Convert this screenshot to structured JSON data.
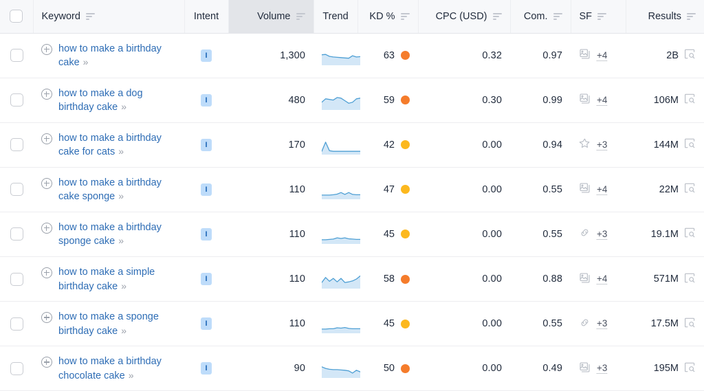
{
  "table": {
    "columns": [
      {
        "key": "checkbox",
        "label": "",
        "sortable": false,
        "align": "center",
        "sorted": false
      },
      {
        "key": "keyword",
        "label": "Keyword",
        "sortable": true,
        "align": "left",
        "sorted": false
      },
      {
        "key": "intent",
        "label": "Intent",
        "sortable": false,
        "align": "center",
        "sorted": false
      },
      {
        "key": "volume",
        "label": "Volume",
        "sortable": true,
        "align": "right",
        "sorted": true
      },
      {
        "key": "trend",
        "label": "Trend",
        "sortable": false,
        "align": "center",
        "sorted": false
      },
      {
        "key": "kd",
        "label": "KD %",
        "sortable": true,
        "align": "right",
        "sorted": false
      },
      {
        "key": "cpc",
        "label": "CPC (USD)",
        "sortable": true,
        "align": "right",
        "sorted": false
      },
      {
        "key": "com",
        "label": "Com.",
        "sortable": true,
        "align": "right",
        "sorted": false
      },
      {
        "key": "sf",
        "label": "SF",
        "sortable": true,
        "align": "left",
        "sorted": false
      },
      {
        "key": "results",
        "label": "Results",
        "sortable": true,
        "align": "right",
        "sorted": false
      }
    ],
    "select_all_checked": false,
    "colors": {
      "header_bg": "#f7f8fa",
      "header_sorted_bg": "#e3e5e9",
      "link": "#2e6db5",
      "intent_badge_bg": "#bedcfa",
      "intent_badge_text": "#1b64b5",
      "kd_orange": "#f57c2b",
      "kd_yellow": "#fcb81e",
      "spark_line": "#4e9fd4",
      "spark_fill": "#d3e7f7",
      "icon_gray": "#b9bec6"
    },
    "rows": [
      {
        "checked": false,
        "keyword": "how to make a birthday cake",
        "expand_icon": "plus-circle-icon",
        "more_icon": "chevron-double-right-icon",
        "intent": "I",
        "intent_name": "informational",
        "volume": "1,300",
        "trend": [
          58,
          60,
          48,
          44,
          42,
          40,
          38,
          36,
          52,
          44,
          46
        ],
        "kd": "63",
        "kd_color": "#f57c2b",
        "cpc": "0.32",
        "com": "0.97",
        "sf_icon": "images-icon",
        "sf_more": "+4",
        "results": "2B",
        "results_icon": "serp-preview-icon"
      },
      {
        "checked": false,
        "keyword": "how to make a dog birthday cake",
        "expand_icon": "plus-circle-icon",
        "more_icon": "chevron-double-right-icon",
        "intent": "I",
        "intent_name": "informational",
        "volume": "480",
        "trend": [
          40,
          62,
          58,
          54,
          70,
          66,
          50,
          34,
          40,
          62,
          66
        ],
        "kd": "59",
        "kd_color": "#f57c2b",
        "cpc": "0.30",
        "com": "0.99",
        "sf_icon": "images-icon",
        "sf_more": "+4",
        "results": "106M",
        "results_icon": "serp-preview-icon"
      },
      {
        "checked": false,
        "keyword": "how to make a birthday cake for cats",
        "expand_icon": "plus-circle-icon",
        "more_icon": "chevron-double-right-icon",
        "intent": "I",
        "intent_name": "informational",
        "volume": "170",
        "trend": [
          12,
          70,
          16,
          12,
          12,
          12,
          12,
          12,
          12,
          12,
          12
        ],
        "kd": "42",
        "kd_color": "#fcb81e",
        "cpc": "0.00",
        "com": "0.94",
        "sf_icon": "star-icon",
        "sf_more": "+3",
        "results": "144M",
        "results_icon": "serp-preview-icon"
      },
      {
        "checked": false,
        "keyword": "how to make a birthday cake sponge",
        "expand_icon": "plus-circle-icon",
        "more_icon": "chevron-double-right-icon",
        "intent": "I",
        "intent_name": "informational",
        "volume": "110",
        "trend": [
          18,
          18,
          18,
          20,
          24,
          34,
          22,
          34,
          22,
          20,
          20
        ],
        "kd": "47",
        "kd_color": "#fcb81e",
        "cpc": "0.00",
        "com": "0.55",
        "sf_icon": "images-icon",
        "sf_more": "+4",
        "results": "22M",
        "results_icon": "serp-preview-icon"
      },
      {
        "checked": false,
        "keyword": "how to make a birthday sponge cake",
        "expand_icon": "plus-circle-icon",
        "more_icon": "chevron-double-right-icon",
        "intent": "I",
        "intent_name": "informational",
        "volume": "110",
        "trend": [
          18,
          18,
          20,
          22,
          30,
          26,
          30,
          24,
          22,
          20,
          20
        ],
        "kd": "45",
        "kd_color": "#fcb81e",
        "cpc": "0.00",
        "com": "0.55",
        "sf_icon": "link-icon",
        "sf_more": "+3",
        "results": "19.1M",
        "results_icon": "serp-preview-icon"
      },
      {
        "checked": false,
        "keyword": "how to make a simple birthday cake",
        "expand_icon": "plus-circle-icon",
        "more_icon": "chevron-double-right-icon",
        "intent": "I",
        "intent_name": "informational",
        "volume": "110",
        "trend": [
          30,
          62,
          38,
          56,
          34,
          56,
          30,
          34,
          40,
          52,
          72
        ],
        "kd": "58",
        "kd_color": "#f57c2b",
        "cpc": "0.00",
        "com": "0.88",
        "sf_icon": "images-icon",
        "sf_more": "+4",
        "results": "571M",
        "results_icon": "serp-preview-icon"
      },
      {
        "checked": false,
        "keyword": "how to make a sponge birthday cake",
        "expand_icon": "plus-circle-icon",
        "more_icon": "chevron-double-right-icon",
        "intent": "I",
        "intent_name": "informational",
        "volume": "110",
        "trend": [
          18,
          18,
          20,
          20,
          26,
          24,
          28,
          22,
          20,
          20,
          20
        ],
        "kd": "45",
        "kd_color": "#fcb81e",
        "cpc": "0.00",
        "com": "0.55",
        "sf_icon": "link-icon",
        "sf_more": "+3",
        "results": "17.5M",
        "results_icon": "serp-preview-icon"
      },
      {
        "checked": false,
        "keyword": "how to make a birthday chocolate cake",
        "expand_icon": "plus-circle-icon",
        "more_icon": "chevron-double-right-icon",
        "intent": "I",
        "intent_name": "informational",
        "volume": "90",
        "trend": [
          62,
          52,
          46,
          44,
          44,
          42,
          40,
          36,
          22,
          40,
          30
        ],
        "kd": "50",
        "kd_color": "#f57c2b",
        "cpc": "0.00",
        "com": "0.49",
        "sf_icon": "images-icon",
        "sf_more": "+3",
        "results": "195M",
        "results_icon": "serp-preview-icon"
      }
    ]
  }
}
